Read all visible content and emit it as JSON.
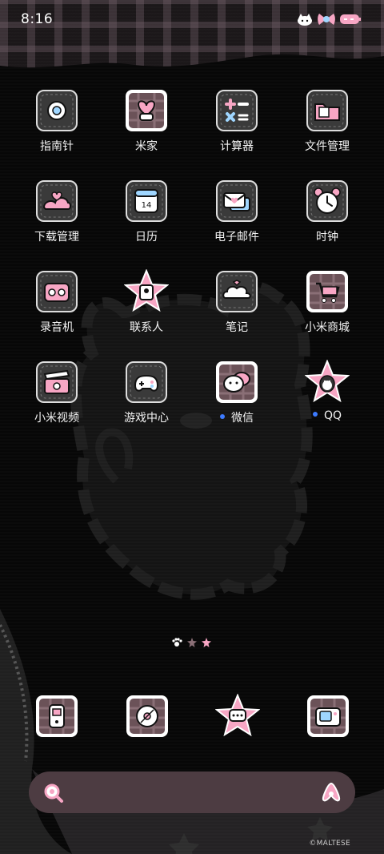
{
  "status_bar": {
    "time": "8:16"
  },
  "apps": [
    {
      "name": "指南针"
    },
    {
      "name": "米家"
    },
    {
      "name": "计算器"
    },
    {
      "name": "文件管理"
    },
    {
      "name": "下载管理"
    },
    {
      "name": "日历"
    },
    {
      "name": "电子邮件"
    },
    {
      "name": "时钟"
    },
    {
      "name": "录音机"
    },
    {
      "name": "联系人"
    },
    {
      "name": "笔记"
    },
    {
      "name": "小米商城"
    },
    {
      "name": "小米视频"
    },
    {
      "name": "游戏中心"
    },
    {
      "name": "微信"
    },
    {
      "name": "QQ"
    }
  ],
  "calendar_icon_day": "14",
  "dock": [
    "phone-icon",
    "music-icon",
    "messages-icon",
    "camera-icon"
  ],
  "page_indicator": {
    "total": 3,
    "current": 1
  },
  "watermark": "©MALTESE",
  "colors": {
    "accent_pink": "#f7a6c4",
    "icon_frame": "#e8e8e8",
    "notification_dot": "#3d7bff",
    "search_bar": "#4d3c42"
  }
}
